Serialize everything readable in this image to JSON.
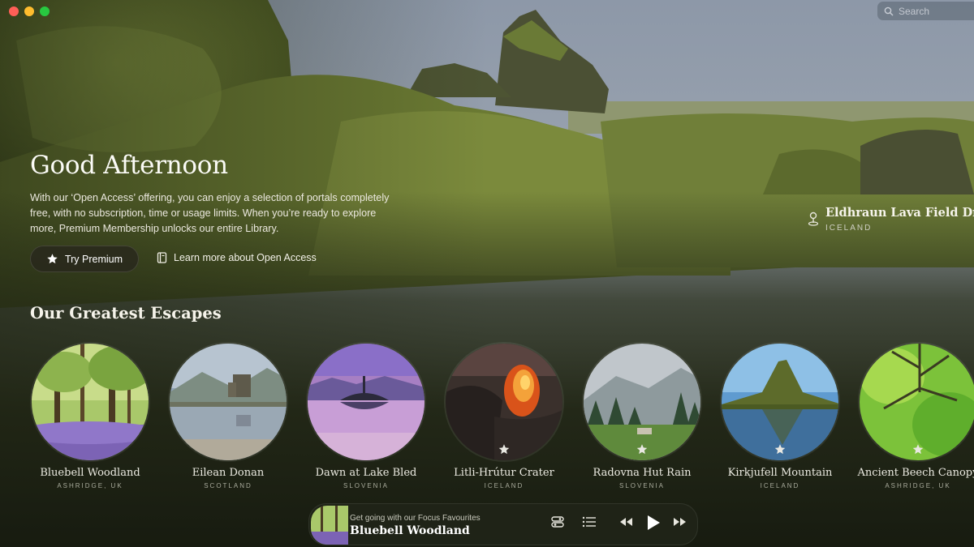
{
  "window": {
    "controls": [
      "close",
      "minimize",
      "maximize"
    ]
  },
  "search": {
    "placeholder": "Search",
    "icon": "search-icon"
  },
  "hero": {
    "greeting": "Good Afternoon",
    "intro": "With our ‘Open Access’ offering, you can enjoy a selection of portals completely free, with no subscription, time or usage limits. When you’re ready to explore more, Premium Membership unlocks our entire Library.",
    "premium_label": "Try Premium",
    "learn_label": "Learn more about Open Access"
  },
  "location": {
    "name": "Eldhraun Lava Field Drips",
    "country": "ICELAND",
    "icon": "location-pin-icon"
  },
  "escapes": {
    "title": "Our Greatest Escapes",
    "items": [
      {
        "title": "Bluebell Woodland",
        "sub": "ASHRIDGE, UK",
        "premium": false
      },
      {
        "title": "Eilean Donan",
        "sub": "SCOTLAND",
        "premium": false
      },
      {
        "title": "Dawn at Lake Bled",
        "sub": "SLOVENIA",
        "premium": false
      },
      {
        "title": "Litli-Hrútur Crater",
        "sub": "ICELAND",
        "premium": true
      },
      {
        "title": "Radovna Hut Rain",
        "sub": "SLOVENIA",
        "premium": true
      },
      {
        "title": "Kirkjufell Mountain",
        "sub": "ICELAND",
        "premium": true
      },
      {
        "title": "Ancient Beech Canopy",
        "sub": "ASHRIDGE, UK",
        "premium": true
      }
    ]
  },
  "player": {
    "hint": "Get going with our Focus Favourites",
    "track": "Bluebell Woodland",
    "controls": [
      "timer-icon",
      "list-icon",
      "rewind-icon",
      "play-icon",
      "fast-forward-icon"
    ]
  },
  "colors": {
    "accent_dark": "#1a1f12",
    "moss": "#5a6b2b",
    "sky": "#a9b4c2"
  }
}
